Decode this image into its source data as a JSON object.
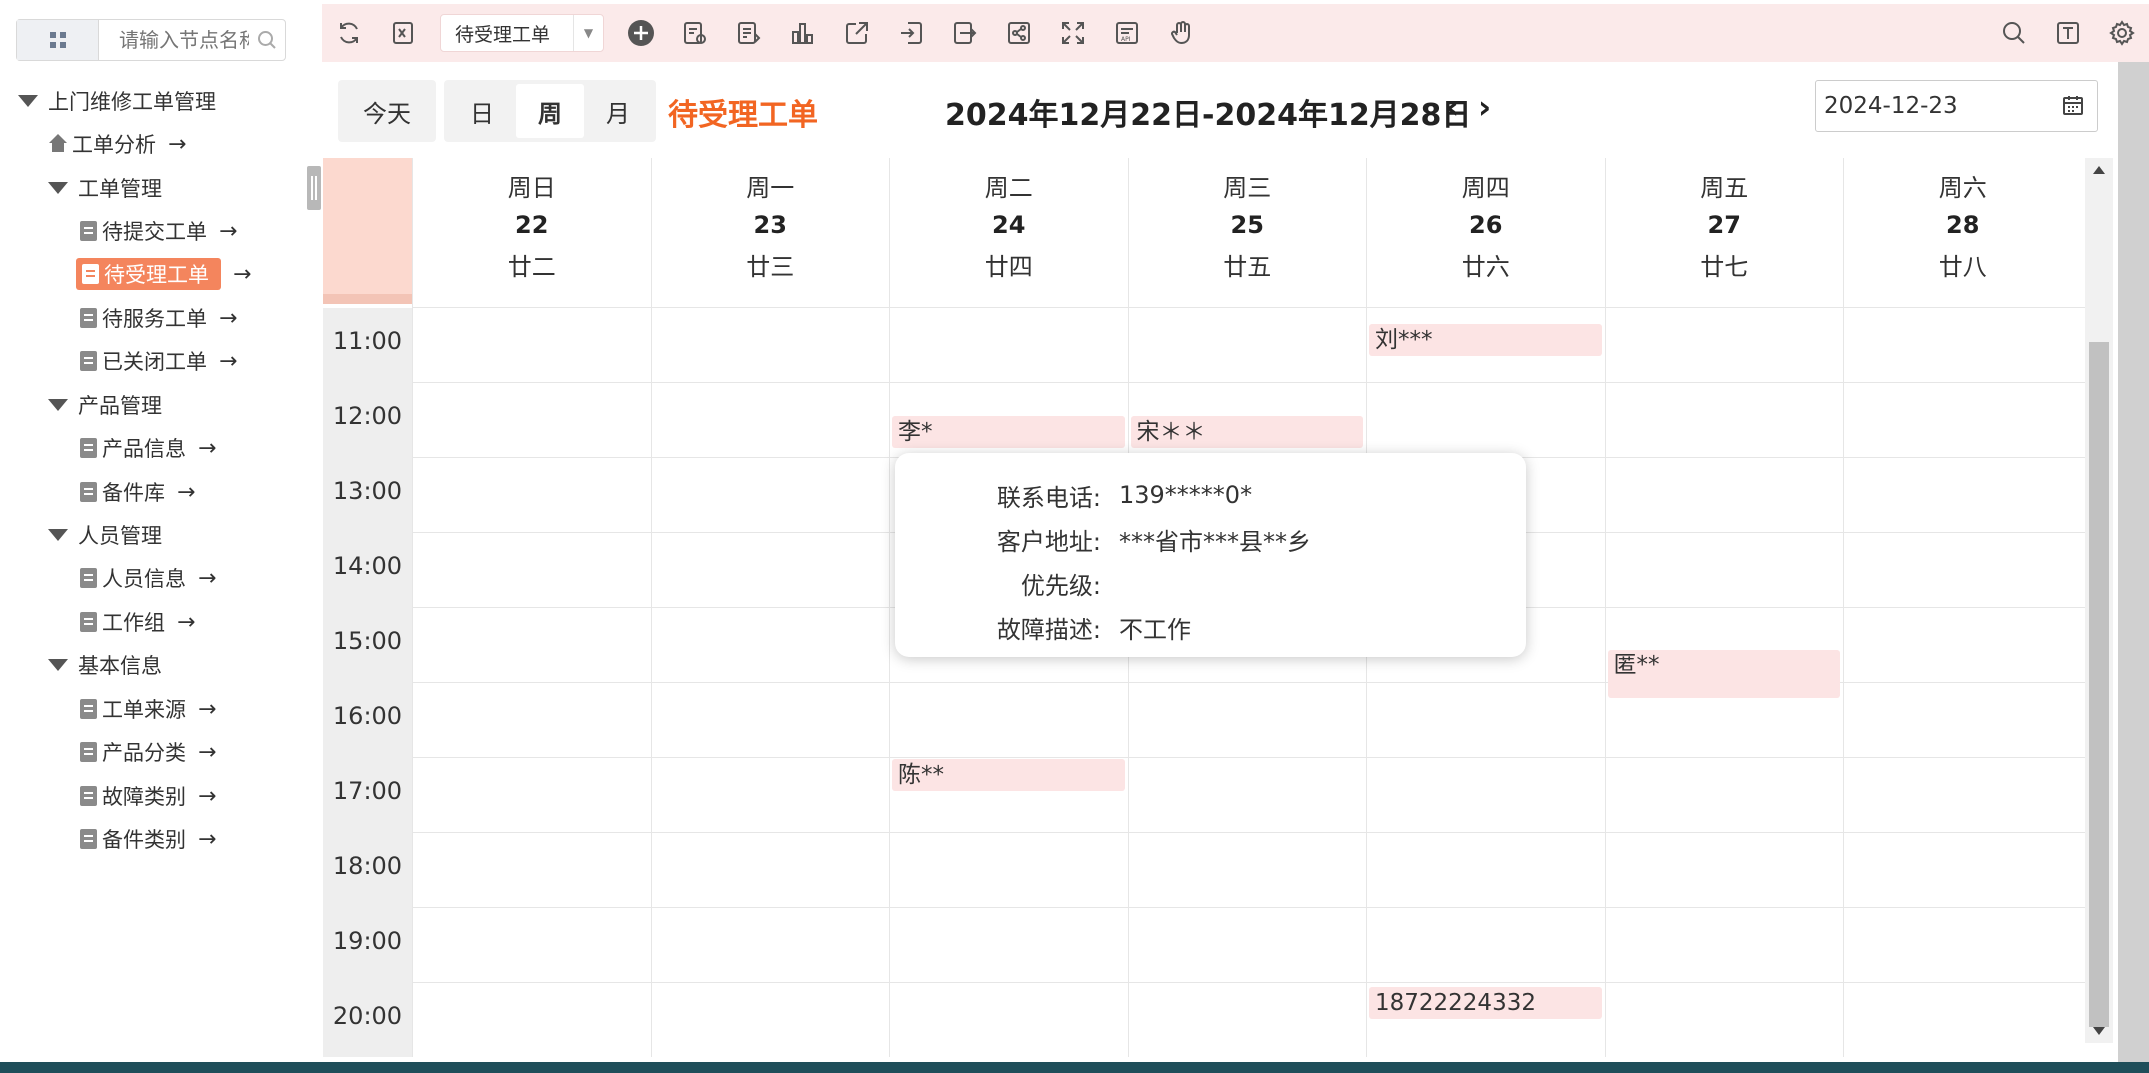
{
  "sidebar": {
    "search_placeholder": "请输入节点名称",
    "root": "上门维修工单管理",
    "items": {
      "analysis": "工单分析",
      "order_mgmt": "工单管理",
      "pending_submit": "待提交工单",
      "pending_accept": "待受理工单",
      "pending_service": "待服务工单",
      "closed": "已关闭工单",
      "product_mgmt": "产品管理",
      "product_info": "产品信息",
      "parts_lib": "备件库",
      "staff_mgmt": "人员管理",
      "staff_info": "人员信息",
      "work_group": "工作组",
      "basic_info": "基本信息",
      "order_source": "工单来源",
      "product_category": "产品分类",
      "fault_type": "故障类别",
      "parts_type": "备件类别"
    },
    "arrow": "→"
  },
  "toolbar": {
    "view_select": "待受理工单",
    "icons_left": [
      "refresh-icon",
      "export-excel-icon",
      "add-icon",
      "settings-form-icon",
      "edit-form-icon",
      "chart-icon",
      "share-icon",
      "import-icon",
      "export-icon",
      "link-icon",
      "fullscreen-icon",
      "api-icon",
      "hand-icon"
    ],
    "icons_right": [
      "search-icon",
      "text-icon",
      "gear-icon"
    ]
  },
  "calendar": {
    "today_label": "今天",
    "views": [
      "日",
      "周",
      "月"
    ],
    "active_view": "周",
    "title": "待受理工单",
    "range": "2024年12月22日-2024年12月28日",
    "prev": "‹",
    "next": "›",
    "date_input": "2024-12-23",
    "days": [
      {
        "week": "周日",
        "date": "22",
        "lunar": "廿二"
      },
      {
        "week": "周一",
        "date": "23",
        "lunar": "廿三"
      },
      {
        "week": "周二",
        "date": "24",
        "lunar": "廿四"
      },
      {
        "week": "周三",
        "date": "25",
        "lunar": "廿五"
      },
      {
        "week": "周四",
        "date": "26",
        "lunar": "廿六"
      },
      {
        "week": "周五",
        "date": "27",
        "lunar": "廿七"
      },
      {
        "week": "周六",
        "date": "28",
        "lunar": "廿八"
      }
    ],
    "times": [
      "11:00",
      "12:00",
      "13:00",
      "14:00",
      "15:00",
      "16:00",
      "17:00",
      "18:00",
      "19:00",
      "20:00"
    ],
    "events": [
      {
        "label": "刘***",
        "day": "周四",
        "time": "11:00"
      },
      {
        "label": "李*",
        "day": "周二",
        "time": "12:00"
      },
      {
        "label": "宋＊＊",
        "day": "周三",
        "time": "12:00"
      },
      {
        "label": "匿**",
        "day": "周五",
        "time": "15:00"
      },
      {
        "label": "陈**",
        "day": "周二",
        "time": "17:00"
      },
      {
        "label": "18722224332",
        "day": "周四",
        "time": "20:00"
      }
    ]
  },
  "tooltip": {
    "rows": [
      {
        "key": "联系电话:",
        "value": "139*****0*"
      },
      {
        "key": "客户地址:",
        "value": "***省市***县**乡"
      },
      {
        "key": "优先级:",
        "value": ""
      },
      {
        "key": "故障描述:",
        "value": "不工作"
      }
    ]
  }
}
